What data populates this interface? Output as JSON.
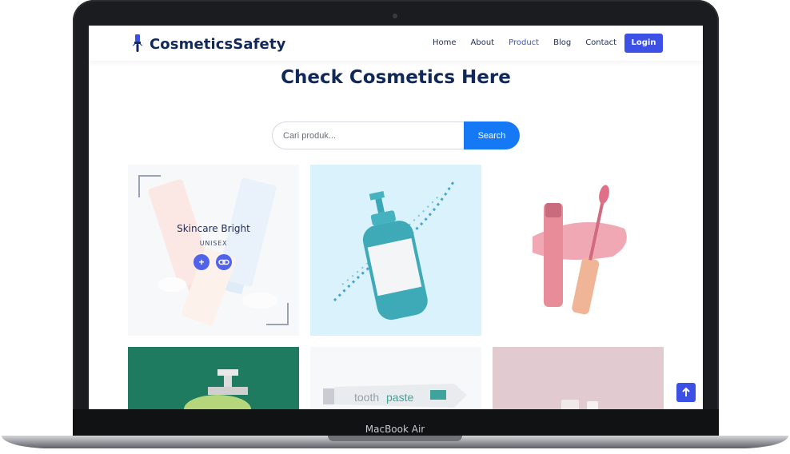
{
  "device": {
    "label": "MacBook Air"
  },
  "navbar": {
    "brand": "CosmeticsSafety",
    "links": [
      {
        "label": "Home",
        "active": false
      },
      {
        "label": "About",
        "active": false
      },
      {
        "label": "Product",
        "active": true
      },
      {
        "label": "Blog",
        "active": false
      },
      {
        "label": "Contact",
        "active": false
      }
    ],
    "login_label": "Login"
  },
  "main": {
    "title": "Check Cosmetics Here",
    "search": {
      "placeholder": "Cari produk...",
      "button_label": "Search"
    }
  },
  "products": [
    {
      "name": "Skincare Bright",
      "category": "UNISEX",
      "image": "skincare-tubes"
    },
    {
      "name": "",
      "image": "pump-bottle-splash"
    },
    {
      "name": "",
      "image": "lip-gloss"
    },
    {
      "name": "",
      "image": "green-pump-bottle"
    },
    {
      "name": "",
      "image": "toothpaste-tube"
    },
    {
      "name": "",
      "image": "cosmetic-jars"
    }
  ],
  "colors": {
    "brand": "#11285a",
    "accent": "#3d50e6",
    "search": "#1579f5"
  }
}
